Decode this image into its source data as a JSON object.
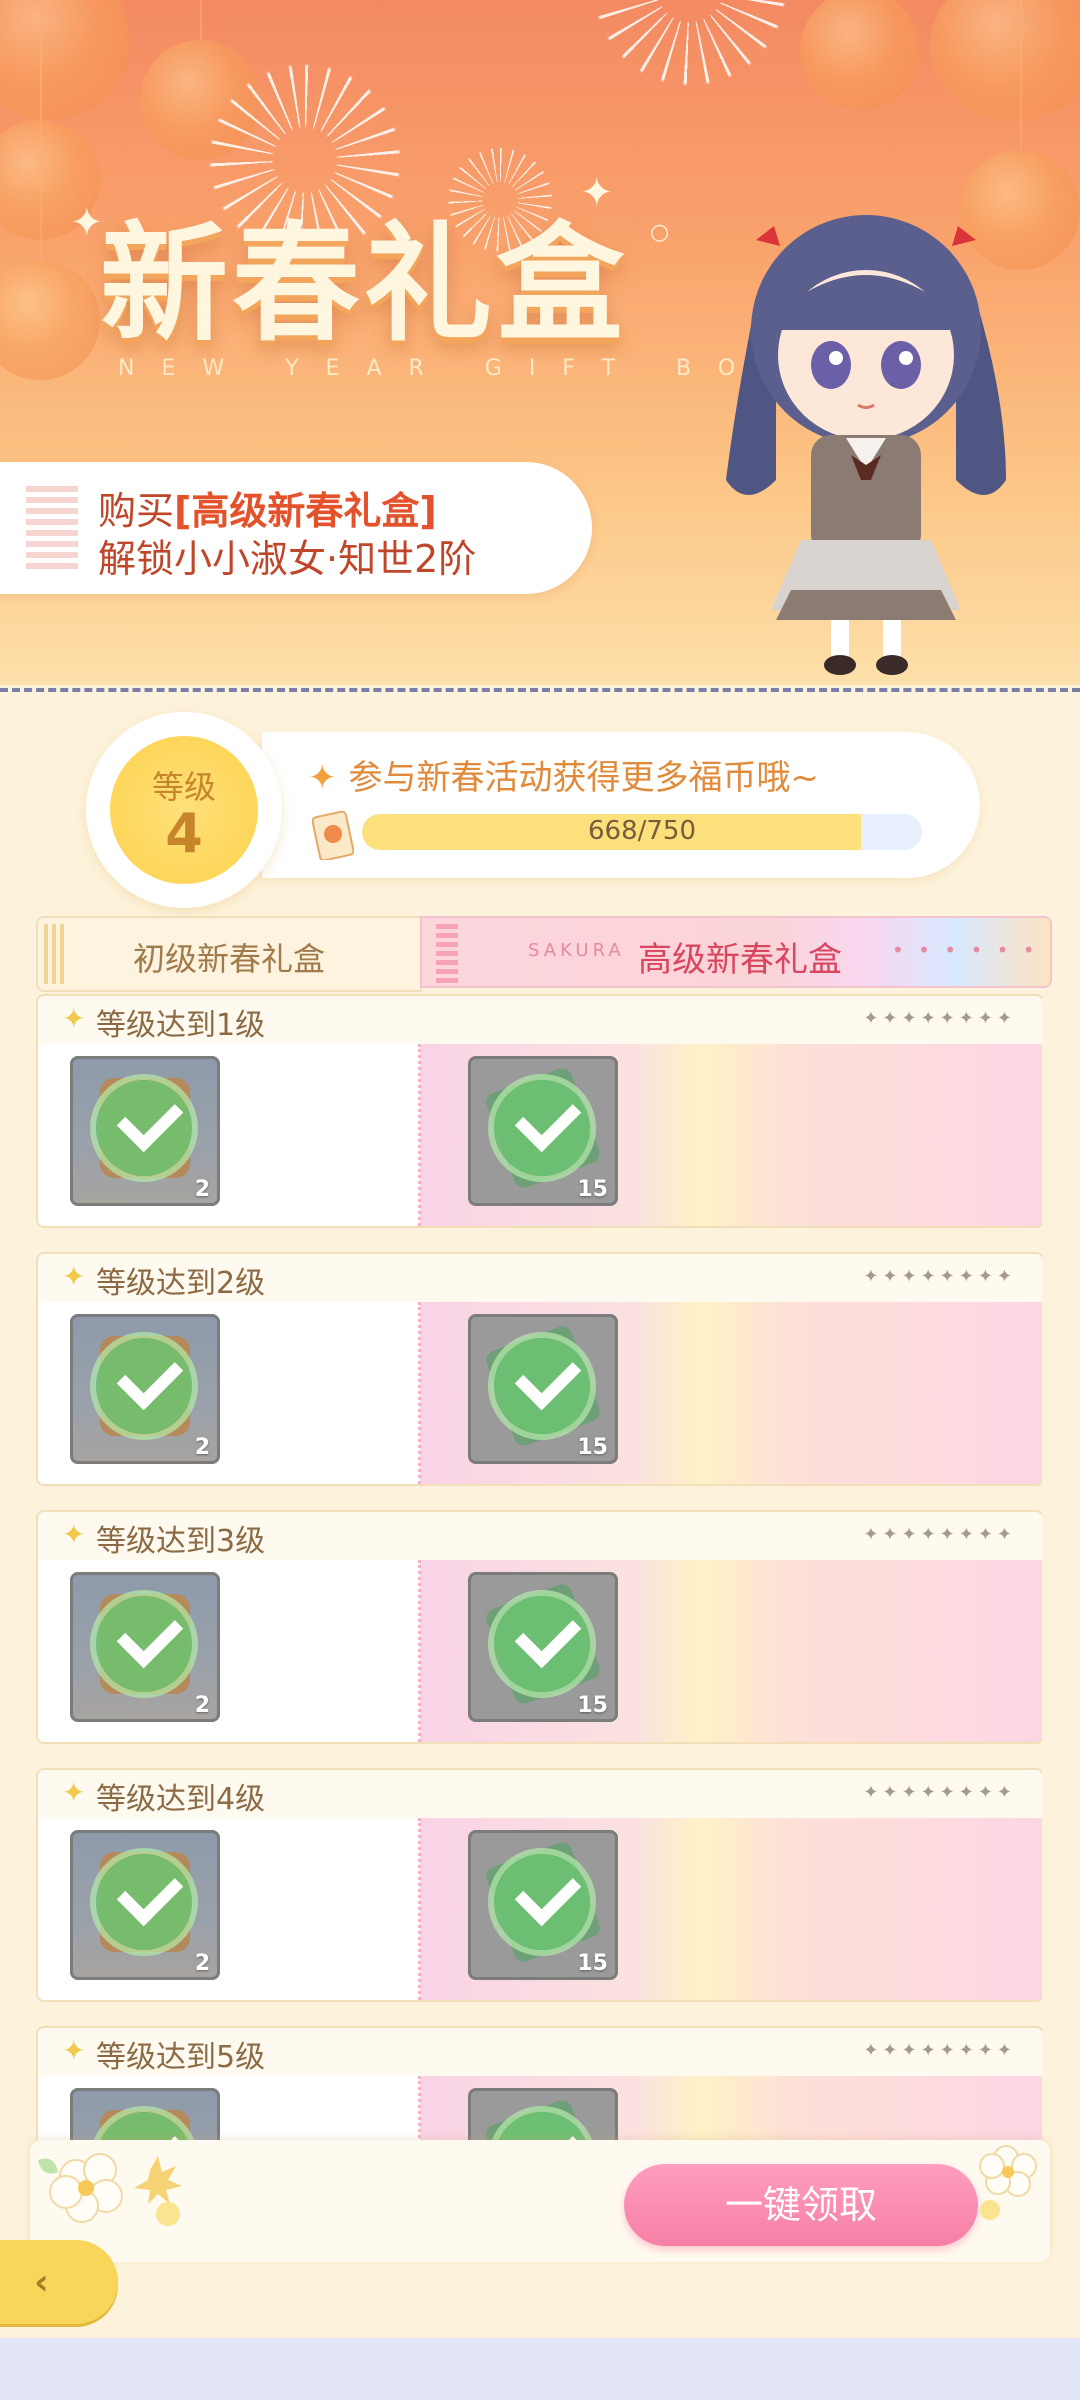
{
  "banner": {
    "title": "新春礼盒",
    "subtitle": "NEW YEAR GIFT BOX",
    "promo_prefix": "购买",
    "promo_highlight": "[高级新春礼盒]",
    "promo_line2": "解锁小小淑女·知世2阶"
  },
  "level": {
    "label": "等级",
    "value": "4",
    "tip": "参与新春活动获得更多福币哦~",
    "progress_text": "668/750",
    "progress_fraction": 0.8907
  },
  "tabs": {
    "basic": "初级新春礼盒",
    "premium_brand": "SAKURA",
    "premium": "高级新春礼盒",
    "premium_dots": "• • • • • •"
  },
  "rows": [
    {
      "label": "等级达到1级",
      "basic_count": "2",
      "premium_count": "15"
    },
    {
      "label": "等级达到2级",
      "basic_count": "2",
      "premium_count": "15"
    },
    {
      "label": "等级达到3级",
      "basic_count": "2",
      "premium_count": "15"
    },
    {
      "label": "等级达到4级",
      "basic_count": "2",
      "premium_count": "15"
    },
    {
      "label": "等级达到5级",
      "basic_count": "",
      "premium_count": ""
    }
  ],
  "row_dots": "✦✦✦✦✦✦✦✦",
  "claim_button": "一键领取",
  "colors": {
    "accent_pink": "#f67fa5",
    "accent_yellow": "#fdd65a",
    "title_red": "#d8475f"
  }
}
